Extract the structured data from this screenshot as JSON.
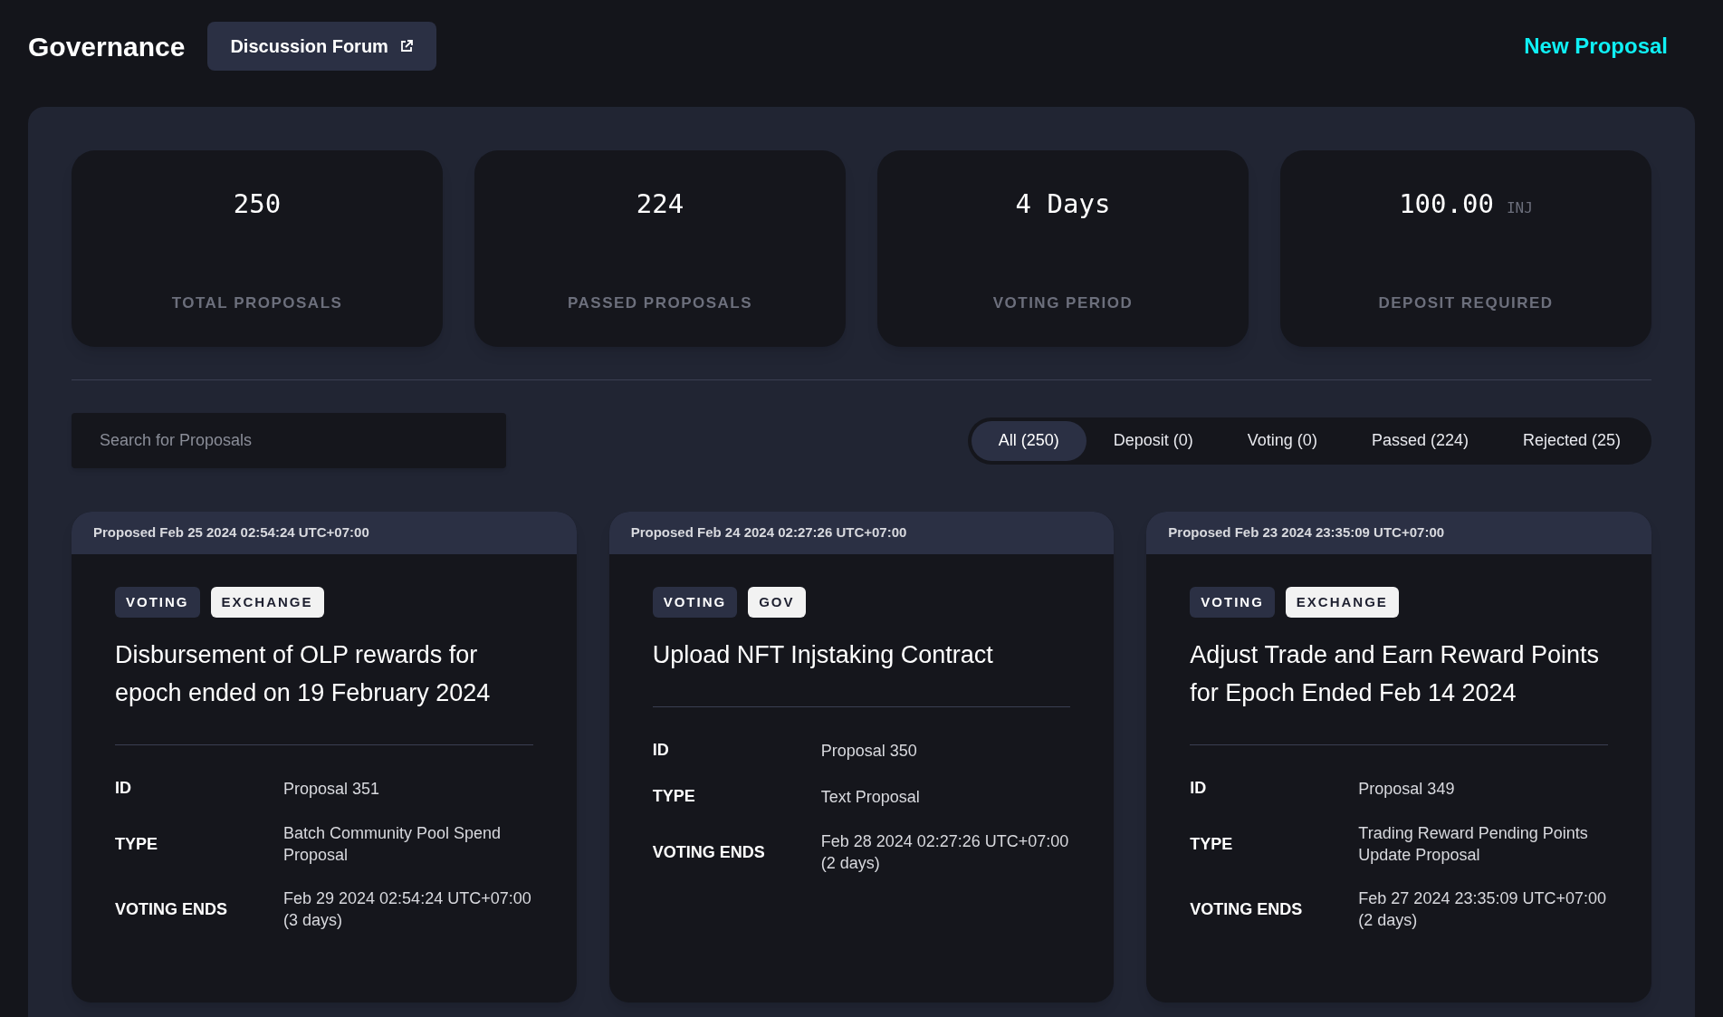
{
  "header": {
    "title": "Governance",
    "forum_button": "Discussion Forum",
    "new_proposal": "New Proposal"
  },
  "stats": [
    {
      "value": "250",
      "label": "TOTAL PROPOSALS"
    },
    {
      "value": "224",
      "label": "PASSED PROPOSALS"
    },
    {
      "value": "4 Days",
      "label": "VOTING PERIOD"
    },
    {
      "value": "100.00",
      "unit": "INJ",
      "label": "DEPOSIT REQUIRED"
    }
  ],
  "search": {
    "placeholder": "Search for Proposals"
  },
  "filters": [
    {
      "label": "All (250)",
      "selected": true
    },
    {
      "label": "Deposit (0)",
      "selected": false
    },
    {
      "label": "Voting (0)",
      "selected": false
    },
    {
      "label": "Passed (224)",
      "selected": false
    },
    {
      "label": "Rejected (25)",
      "selected": false
    }
  ],
  "proposals": [
    {
      "proposed": "Proposed Feb 25 2024 02:54:24 UTC+07:00",
      "tags": [
        {
          "label": "VOTING",
          "kind": "status"
        },
        {
          "label": "EXCHANGE",
          "kind": "module"
        }
      ],
      "title": "Disbursement of OLP rewards for epoch ended on 19 February 2024",
      "fields": [
        {
          "label": "ID",
          "value": "Proposal 351"
        },
        {
          "label": "TYPE",
          "value": "Batch Community Pool Spend Proposal"
        },
        {
          "label": "VOTING ENDS",
          "value": "Feb 29 2024 02:54:24 UTC+07:00 (3 days)"
        }
      ]
    },
    {
      "proposed": "Proposed Feb 24 2024 02:27:26 UTC+07:00",
      "tags": [
        {
          "label": "VOTING",
          "kind": "status"
        },
        {
          "label": "GOV",
          "kind": "module"
        }
      ],
      "title": "Upload NFT Injstaking Contract",
      "fields": [
        {
          "label": "ID",
          "value": "Proposal 350"
        },
        {
          "label": "TYPE",
          "value": "Text Proposal"
        },
        {
          "label": "VOTING ENDS",
          "value": "Feb 28 2024 02:27:26 UTC+07:00 (2 days)"
        }
      ]
    },
    {
      "proposed": "Proposed Feb 23 2024 23:35:09 UTC+07:00",
      "tags": [
        {
          "label": "VOTING",
          "kind": "status"
        },
        {
          "label": "EXCHANGE",
          "kind": "module"
        }
      ],
      "title": "Adjust Trade and Earn Reward Points for Epoch Ended Feb 14 2024",
      "fields": [
        {
          "label": "ID",
          "value": "Proposal 349"
        },
        {
          "label": "TYPE",
          "value": "Trading Reward Pending Points Update Proposal"
        },
        {
          "label": "VOTING ENDS",
          "value": "Feb 27 2024 23:35:09 UTC+07:00 (2 days)"
        }
      ]
    }
  ]
}
